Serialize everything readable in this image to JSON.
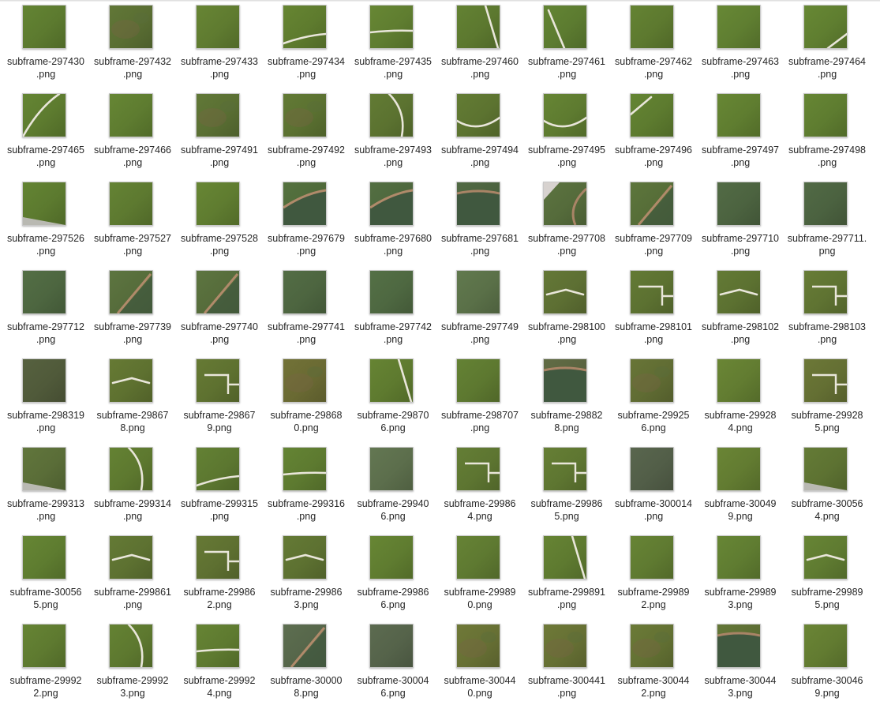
{
  "files": [
    {
      "name": "subframe-297430.png",
      "lines": [
        "subframe-297430",
        ".png"
      ],
      "tone": "#5c7a2f",
      "mark": "none"
    },
    {
      "name": "subframe-297432.png",
      "lines": [
        "subframe-297432",
        ".png"
      ],
      "tone": "#5a6e33",
      "mark": "patch"
    },
    {
      "name": "subframe-297433.png",
      "lines": [
        "subframe-297433",
        ".png"
      ],
      "tone": "#5f7b30",
      "mark": "none"
    },
    {
      "name": "subframe-297434.png",
      "lines": [
        "subframe-297434",
        ".png"
      ],
      "tone": "#5e7b2e",
      "mark": "curve-low"
    },
    {
      "name": "subframe-297435.png",
      "lines": [
        "subframe-297435",
        ".png"
      ],
      "tone": "#5f7d30",
      "mark": "line-horiz"
    },
    {
      "name": "subframe-297460.png",
      "lines": [
        "subframe-297460",
        ".png"
      ],
      "tone": "#5c782f",
      "mark": "diag-steep"
    },
    {
      "name": "subframe-297461.png",
      "lines": [
        "subframe-297461",
        ".png"
      ],
      "tone": "#5c7b30",
      "mark": "diag-left"
    },
    {
      "name": "subframe-297462.png",
      "lines": [
        "subframe-297462",
        ".png"
      ],
      "tone": "#5d792f",
      "mark": "none"
    },
    {
      "name": "subframe-297463.png",
      "lines": [
        "subframe-297463",
        ".png"
      ],
      "tone": "#5f7e31",
      "mark": "none"
    },
    {
      "name": "subframe-297464.png",
      "lines": [
        "subframe-297464",
        ".png"
      ],
      "tone": "#5f7e30",
      "mark": "diag-corner"
    },
    {
      "name": "subframe-297465.png",
      "lines": [
        "subframe-297465",
        ".png"
      ],
      "tone": "#5d7b2f",
      "mark": "curve-top"
    },
    {
      "name": "subframe-297466.png",
      "lines": [
        "subframe-297466",
        ".png"
      ],
      "tone": "#5e7c30",
      "mark": "none"
    },
    {
      "name": "subframe-297491.png",
      "lines": [
        "subframe-297491",
        ".png"
      ],
      "tone": "#5a6f33",
      "mark": "patch"
    },
    {
      "name": "subframe-297492.png",
      "lines": [
        "subframe-297492",
        ".png"
      ],
      "tone": "#5b7131",
      "mark": "patch"
    },
    {
      "name": "subframe-297493.png",
      "lines": [
        "subframe-297493",
        ".png"
      ],
      "tone": "#5b7230",
      "mark": "curve-right"
    },
    {
      "name": "subframe-297494.png",
      "lines": [
        "subframe-297494",
        ".png"
      ],
      "tone": "#5c7330",
      "mark": "curve-mid"
    },
    {
      "name": "subframe-297495.png",
      "lines": [
        "subframe-297495",
        ".png"
      ],
      "tone": "#5e7b30",
      "mark": "curve-mid"
    },
    {
      "name": "subframe-297496.png",
      "lines": [
        "subframe-297496",
        ".png"
      ],
      "tone": "#5d7b2f",
      "mark": "diag-corner-tl"
    },
    {
      "name": "subframe-297497.png",
      "lines": [
        "subframe-297497",
        ".png"
      ],
      "tone": "#5f7d30",
      "mark": "none"
    },
    {
      "name": "subframe-297498.png",
      "lines": [
        "subframe-297498",
        ".png"
      ],
      "tone": "#5e7c30",
      "mark": "none"
    },
    {
      "name": "subframe-297526.png",
      "lines": [
        "subframe-297526",
        ".png"
      ],
      "tone": "#5c7a2f",
      "mark": "edge-bl"
    },
    {
      "name": "subframe-297527.png",
      "lines": [
        "subframe-297527",
        ".png"
      ],
      "tone": "#5d7930",
      "mark": "none"
    },
    {
      "name": "subframe-297528.png",
      "lines": [
        "subframe-297528",
        ".png"
      ],
      "tone": "#5f7c30",
      "mark": "none"
    },
    {
      "name": "subframe-297679.png",
      "lines": [
        "subframe-297679",
        ".png"
      ],
      "tone": "#4f6a3a",
      "mark": "water-arc"
    },
    {
      "name": "subframe-297680.png",
      "lines": [
        "subframe-297680",
        ".png"
      ],
      "tone": "#4d673d",
      "mark": "water-arc"
    },
    {
      "name": "subframe-297681.png",
      "lines": [
        "subframe-297681",
        ".png"
      ],
      "tone": "#4b623f",
      "mark": "water-top"
    },
    {
      "name": "subframe-297708.png",
      "lines": [
        "subframe-297708",
        ".png"
      ],
      "tone": "#556b3b",
      "mark": "water-corner"
    },
    {
      "name": "subframe-297709.png",
      "lines": [
        "subframe-297709",
        ".png"
      ],
      "tone": "#566d38",
      "mark": "water-diag"
    },
    {
      "name": "subframe-297710.png",
      "lines": [
        "subframe-297710",
        ".png"
      ],
      "tone": "#4c6340",
      "mark": "none"
    },
    {
      "name": "subframe-297711.png",
      "lines": [
        "subframe-297711.",
        "png"
      ],
      "tone": "#4b6240",
      "mark": "none"
    },
    {
      "name": "subframe-297712.png",
      "lines": [
        "subframe-297712",
        ".png"
      ],
      "tone": "#4d6640",
      "mark": "none"
    },
    {
      "name": "subframe-297739.png",
      "lines": [
        "subframe-297739",
        ".png"
      ],
      "tone": "#566c3b",
      "mark": "water-diag"
    },
    {
      "name": "subframe-297740.png",
      "lines": [
        "subframe-297740",
        ".png"
      ],
      "tone": "#566c3b",
      "mark": "water-diag"
    },
    {
      "name": "subframe-297741.png",
      "lines": [
        "subframe-297741",
        ".png"
      ],
      "tone": "#4d6540",
      "mark": "none"
    },
    {
      "name": "subframe-297742.png",
      "lines": [
        "subframe-297742",
        ".png"
      ],
      "tone": "#4e6841",
      "mark": "none"
    },
    {
      "name": "subframe-297749.png",
      "lines": [
        "subframe-297749",
        ".png"
      ],
      "tone": "#5a7048",
      "mark": "none"
    },
    {
      "name": "subframe-298100.png",
      "lines": [
        "subframe-298100",
        ".png"
      ],
      "tone": "#5d6f33",
      "mark": "field-lines"
    },
    {
      "name": "subframe-298101.png",
      "lines": [
        "subframe-298101",
        ".png"
      ],
      "tone": "#5c7131",
      "mark": "field-corner"
    },
    {
      "name": "subframe-298102.png",
      "lines": [
        "subframe-298102",
        ".png"
      ],
      "tone": "#5c7131",
      "mark": "field-lines"
    },
    {
      "name": "subframe-298103.png",
      "lines": [
        "subframe-298103",
        ".png"
      ],
      "tone": "#5f7332",
      "mark": "field-corner"
    },
    {
      "name": "subframe-298319.png",
      "lines": [
        "subframe-298319",
        ".png"
      ],
      "tone": "#505a3a",
      "mark": "none"
    },
    {
      "name": "subframe-298678.png",
      "lines": [
        "subframe-29867",
        "8.png"
      ],
      "tone": "#5e7130",
      "mark": "field-lines"
    },
    {
      "name": "subframe-298679.png",
      "lines": [
        "subframe-29867",
        "9.png"
      ],
      "tone": "#5e7130",
      "mark": "field-corner"
    },
    {
      "name": "subframe-298680.png",
      "lines": [
        "subframe-29868",
        "0.png"
      ],
      "tone": "#6a6a33",
      "mark": "patch"
    },
    {
      "name": "subframe-298706.png",
      "lines": [
        "subframe-29870",
        "6.png"
      ],
      "tone": "#5e7a2f",
      "mark": "diag-steep"
    },
    {
      "name": "subframe-298707.png",
      "lines": [
        "subframe-298707",
        ".png"
      ],
      "tone": "#5d7830",
      "mark": "none"
    },
    {
      "name": "subframe-298828.png",
      "lines": [
        "subframe-29882",
        "8.png"
      ],
      "tone": "#5a6440",
      "mark": "water-top"
    },
    {
      "name": "subframe-299256.png",
      "lines": [
        "subframe-29925",
        "6.png"
      ],
      "tone": "#606c33",
      "mark": "patch"
    },
    {
      "name": "subframe-299284.png",
      "lines": [
        "subframe-29928",
        "4.png"
      ],
      "tone": "#627c31",
      "mark": "none"
    },
    {
      "name": "subframe-299285.png",
      "lines": [
        "subframe-29928",
        "5.png"
      ],
      "tone": "#646f33",
      "mark": "field-corner"
    },
    {
      "name": "subframe-299313.png",
      "lines": [
        "subframe-299313",
        ".png"
      ],
      "tone": "#5a6d38",
      "mark": "edge-bl"
    },
    {
      "name": "subframe-299314.png",
      "lines": [
        "subframe-299314",
        ".png"
      ],
      "tone": "#5d782f",
      "mark": "curve-right"
    },
    {
      "name": "subframe-299315.png",
      "lines": [
        "subframe-299315",
        ".png"
      ],
      "tone": "#5c7730",
      "mark": "curve-low"
    },
    {
      "name": "subframe-299316.png",
      "lines": [
        "subframe-299316",
        ".png"
      ],
      "tone": "#5d7a30",
      "mark": "line-horiz"
    },
    {
      "name": "subframe-299406.png",
      "lines": [
        "subframe-29940",
        "6.png"
      ],
      "tone": "#5c6e4c",
      "mark": "none"
    },
    {
      "name": "subframe-299864.png",
      "lines": [
        "subframe-29986",
        "4.png"
      ],
      "tone": "#5d7531",
      "mark": "field-corner"
    },
    {
      "name": "subframe-299865.png",
      "lines": [
        "subframe-29986",
        "5.png"
      ],
      "tone": "#5e7631",
      "mark": "field-corner"
    },
    {
      "name": "subframe-300014.png",
      "lines": [
        "subframe-300014",
        ".png"
      ],
      "tone": "#525e48",
      "mark": "none"
    },
    {
      "name": "subframe-300499.png",
      "lines": [
        "subframe-30049",
        "9.png"
      ],
      "tone": "#627b31",
      "mark": "none"
    },
    {
      "name": "subframe-300564.png",
      "lines": [
        "subframe-30056",
        "4.png"
      ],
      "tone": "#5d7232",
      "mark": "edge-bl"
    },
    {
      "name": "subframe-300565.png",
      "lines": [
        "subframe-30056",
        "5.png"
      ],
      "tone": "#5e7c30",
      "mark": "none"
    },
    {
      "name": "subframe-299861.png",
      "lines": [
        "subframe-299861",
        ".png"
      ],
      "tone": "#5d7131",
      "mark": "field-lines"
    },
    {
      "name": "subframe-299862.png",
      "lines": [
        "subframe-29986",
        "2.png"
      ],
      "tone": "#5e7031",
      "mark": "field-corner"
    },
    {
      "name": "subframe-299863.png",
      "lines": [
        "subframe-29986",
        "3.png"
      ],
      "tone": "#5d7131",
      "mark": "field-lines"
    },
    {
      "name": "subframe-299866.png",
      "lines": [
        "subframe-29986",
        "6.png"
      ],
      "tone": "#5f7c30",
      "mark": "none"
    },
    {
      "name": "subframe-299890.png",
      "lines": [
        "subframe-29989",
        "0.png"
      ],
      "tone": "#5e7931",
      "mark": "none"
    },
    {
      "name": "subframe-299891.png",
      "lines": [
        "subframe-299891",
        ".png"
      ],
      "tone": "#5e7a30",
      "mark": "diag-steep"
    },
    {
      "name": "subframe-299892.png",
      "lines": [
        "subframe-29989",
        "2.png"
      ],
      "tone": "#5f7a31",
      "mark": "none"
    },
    {
      "name": "subframe-299893.png",
      "lines": [
        "subframe-29989",
        "3.png"
      ],
      "tone": "#5f7c31",
      "mark": "none"
    },
    {
      "name": "subframe-299895.png",
      "lines": [
        "subframe-29989",
        "5.png"
      ],
      "tone": "#5f7b31",
      "mark": "field-lines"
    },
    {
      "name": "subframe-299922.png",
      "lines": [
        "subframe-29992",
        "2.png"
      ],
      "tone": "#5e7a30",
      "mark": "none"
    },
    {
      "name": "subframe-299923.png",
      "lines": [
        "subframe-29992",
        "3.png"
      ],
      "tone": "#5d782f",
      "mark": "curve-right"
    },
    {
      "name": "subframe-299924.png",
      "lines": [
        "subframe-29992",
        "4.png"
      ],
      "tone": "#5e7a30",
      "mark": "line-horiz"
    },
    {
      "name": "subframe-300008.png",
      "lines": [
        "subframe-30000",
        "8.png"
      ],
      "tone": "#56664a",
      "mark": "water-diag"
    },
    {
      "name": "subframe-300046.png",
      "lines": [
        "subframe-30004",
        "6.png"
      ],
      "tone": "#55634a",
      "mark": "none"
    },
    {
      "name": "subframe-300440.png",
      "lines": [
        "subframe-30044",
        "0.png"
      ],
      "tone": "#677034",
      "mark": "patch"
    },
    {
      "name": "subframe-300441.png",
      "lines": [
        "subframe-300441",
        ".png"
      ],
      "tone": "#667034",
      "mark": "patch"
    },
    {
      "name": "subframe-300442.png",
      "lines": [
        "subframe-30044",
        "2.png"
      ],
      "tone": "#637133",
      "mark": "patch"
    },
    {
      "name": "subframe-300443.png",
      "lines": [
        "subframe-30044",
        "3.png"
      ],
      "tone": "#5d6e34",
      "mark": "water-top"
    },
    {
      "name": "subframe-300469.png",
      "lines": [
        "subframe-30046",
        "9.png"
      ],
      "tone": "#627b31",
      "mark": "none"
    }
  ]
}
